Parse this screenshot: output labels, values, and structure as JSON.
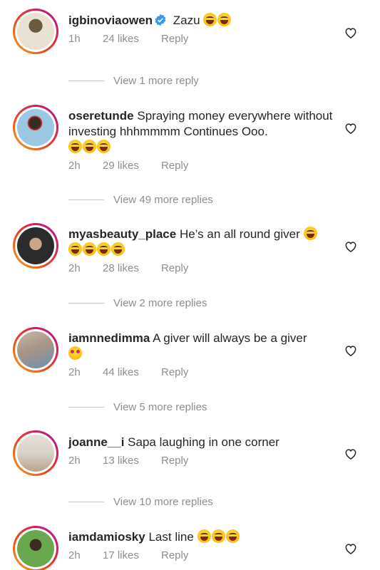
{
  "comments": [
    {
      "username": "igbinoviaowen",
      "verified": true,
      "text": "Zazu",
      "emojis": [
        "laugh",
        "laugh"
      ],
      "time": "1h",
      "likes": "24 likes",
      "reply": "Reply",
      "view_replies": "View 1 more reply",
      "avatar_colors": [
        "#6b5a3e",
        "#e8e1d4"
      ]
    },
    {
      "username": "oseretunde",
      "verified": false,
      "text": "Spraying money everywhere without investing hhhmmmm Continues Ooo.",
      "emojis": [
        "laugh",
        "laugh",
        "laugh"
      ],
      "time": "2h",
      "likes": "29 likes",
      "reply": "Reply",
      "view_replies": "View 49 more replies",
      "avatar_colors": [
        "#9cc7e3",
        "#3b2a24"
      ]
    },
    {
      "username": "myasbeauty_place",
      "verified": false,
      "text": "He’s an all round giver",
      "emojis": [
        "laugh",
        "laugh",
        "laugh",
        "laugh",
        "laugh"
      ],
      "time": "2h",
      "likes": "28 likes",
      "reply": "Reply",
      "view_replies": "View 2 more replies",
      "avatar_colors": [
        "#2b2b2b",
        "#c9a68a"
      ]
    },
    {
      "username": "iamnnedimma",
      "verified": false,
      "text": "A giver will always be a giver",
      "emojis": [
        "hearts"
      ],
      "time": "2h",
      "likes": "44 likes",
      "reply": "Reply",
      "view_replies": "View 5 more replies",
      "avatar_colors": [
        "#c9b7a8",
        "#6f8fb0"
      ]
    },
    {
      "username": "joanne__i",
      "verified": false,
      "text": "Sapa laughing in one corner",
      "emojis": [],
      "time": "2h",
      "likes": "13 likes",
      "reply": "Reply",
      "view_replies": "View 10 more replies",
      "avatar_colors": [
        "#d8d2c8",
        "#b8a38f"
      ]
    },
    {
      "username": "iamdamiosky",
      "verified": false,
      "text": "Last line",
      "emojis": [
        "laugh",
        "laugh",
        "laugh"
      ],
      "time": "2h",
      "likes": "17 likes",
      "reply": "Reply",
      "view_replies": "",
      "avatar_colors": [
        "#6aa84f",
        "#3d2b20"
      ]
    }
  ],
  "colors": {
    "text": "#262626",
    "secondary": "#8e8e8e",
    "verified": "#3897f0",
    "story_ring": [
      "#f9a825",
      "#d81b60",
      "#8e24aa"
    ]
  },
  "icons": {
    "like": "heart-outline-icon",
    "verified": "verified-badge-icon"
  }
}
